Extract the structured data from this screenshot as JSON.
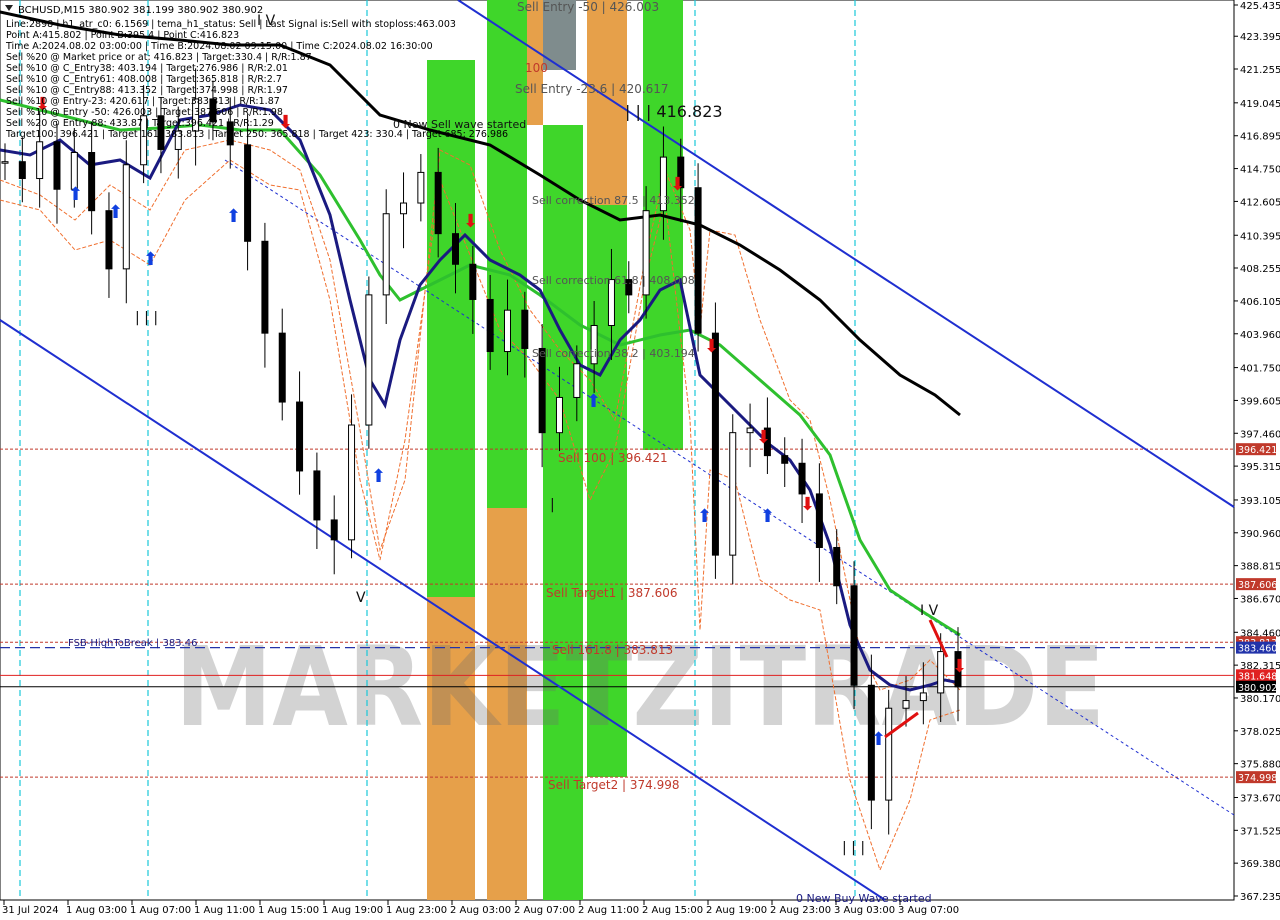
{
  "window": {
    "symbol_header": "BCHUSD,M15  380.902 381.199 380.902 380.902"
  },
  "info_lines": [
    "Line:2898 | h1_atr_c0: 6.1569 | tema_h1_status: Sell | Last Signal is:Sell with stoploss:463.003",
    "Point A:415.802 | Point B:395.4 | Point C:416.823",
    "Time A:2024.08.02 03:00:00 | Time B:2024.08.02 09:15:00 | Time C:2024.08.02 16:30:00",
    "Sell %20 @ Market price or at: 416.823 | Target:330.4 | R/R:1.87",
    "Sell %10 @ C_Entry38: 403.194 | Target:276.986 | R/R:2.01",
    "Sell %10 @ C_Entry61: 408.008 | Target:365.818 | R/R:2.7",
    "Sell %10 @ C_Entry88: 413.352 | Target:374.998 | R/R:1.97",
    "Sell %10 @ Entry-23: 420.617 | Target:383.813 | R/R:1.87",
    "Sell %10 @ Entry -50: 426.003 | Target:387.606 | R/R:1.98",
    "Sell %20 @ Entry-88: 433.87 | Target:396.421 | R/R:1.29",
    "Target100: 396.421 | Target 161: 383.813 | Target 250: 365.818 | Target 423: 330.4 | Target 685: 276.986"
  ],
  "annotations": {
    "sell_entry_50": "Sell Entry -50 | 426.003",
    "sell_entry_23": "Sell Entry -23.6 | 420.617",
    "point_c_label": "| | | 416.823",
    "new_sell_wave": "0 New Sell wave started",
    "sell_corr_875": "Sell correction 87.5 | 413.352",
    "sell_corr_618": "Sell correction 61.8 | 408.008",
    "sell_corr_382": "Sell correction 38.2 | 403.194",
    "sell_100": "Sell 100 | 396.421",
    "sell_target1": "Sell Target1 | 387.606",
    "fsb_label": "FSB-HighToBreak | 383.46",
    "sell_161": "Sell 161.8 | 383.813",
    "sell_target2": "Sell Target2 | 374.998",
    "new_buy_wave": "0 New Buy Wave started",
    "label_100": "100",
    "watermark": "MARKETZITRADE"
  },
  "chart_data": {
    "type": "candlestick",
    "symbol": "BCHUSD",
    "timeframe": "M15",
    "last_price": 380.902,
    "y_axis": {
      "ticks": [
        "425.435",
        "423.395",
        "421.255",
        "419.045",
        "416.895",
        "414.750",
        "412.605",
        "410.395",
        "408.255",
        "406.105",
        "403.960",
        "401.750",
        "399.605",
        "397.460",
        "395.315",
        "393.105",
        "390.960",
        "388.815",
        "386.670",
        "384.460",
        "382.315",
        "380.170",
        "378.025",
        "375.880",
        "373.670",
        "371.525",
        "369.380",
        "367.235"
      ],
      "range": [
        367.235,
        425.435
      ]
    },
    "x_axis": {
      "ticks": [
        "31 Jul 2024",
        "1 Aug 03:00",
        "1 Aug 07:00",
        "1 Aug 11:00",
        "1 Aug 15:00",
        "1 Aug 19:00",
        "1 Aug 23:00",
        "2 Aug 03:00",
        "2 Aug 07:00",
        "2 Aug 11:00",
        "2 Aug 15:00",
        "2 Aug 19:00",
        "2 Aug 23:00",
        "3 Aug 03:00",
        "3 Aug 07:00"
      ]
    },
    "price_levels": [
      {
        "label": "396.421",
        "value": 396.421,
        "color": "#c0392b"
      },
      {
        "label": "387.606",
        "value": 387.606,
        "color": "#c0392b"
      },
      {
        "label": "383.813",
        "value": 383.813,
        "color": "#c0392b"
      },
      {
        "label": "383.460",
        "value": 383.46,
        "color": "#2233aa"
      },
      {
        "label": "381.648",
        "value": 381.648,
        "color": "#e02020"
      },
      {
        "label": "380.902",
        "value": 380.902,
        "color": "#000000"
      },
      {
        "label": "374.998",
        "value": 374.998,
        "color": "#c0392b"
      }
    ],
    "close_series": [
      {
        "t": "31 Jul 21:00",
        "c": 415.2
      },
      {
        "t": "1 Aug 00:00",
        "c": 414.1
      },
      {
        "t": "1 Aug 01:00",
        "c": 416.5
      },
      {
        "t": "1 Aug 03:00",
        "c": 413.4
      },
      {
        "t": "1 Aug 05:00",
        "c": 415.8
      },
      {
        "t": "1 Aug 07:00",
        "c": 412.0
      },
      {
        "t": "1 Aug 08:00",
        "c": 408.2
      },
      {
        "t": "1 Aug 09:00",
        "c": 415.0
      },
      {
        "t": "1 Aug 10:00",
        "c": 418.2
      },
      {
        "t": "1 Aug 11:00",
        "c": 416.0
      },
      {
        "t": "1 Aug 12:00",
        "c": 417.2
      },
      {
        "t": "1 Aug 13:00",
        "c": 419.3
      },
      {
        "t": "1 Aug 14:00",
        "c": 417.8
      },
      {
        "t": "1 Aug 15:00",
        "c": 416.3
      },
      {
        "t": "1 Aug 16:00",
        "c": 410.0
      },
      {
        "t": "1 Aug 17:00",
        "c": 404.0
      },
      {
        "t": "1 Aug 18:00",
        "c": 399.5
      },
      {
        "t": "1 Aug 19:00",
        "c": 395.0
      },
      {
        "t": "1 Aug 20:00",
        "c": 391.8
      },
      {
        "t": "1 Aug 21:00",
        "c": 390.5
      },
      {
        "t": "1 Aug 22:00",
        "c": 398.0
      },
      {
        "t": "1 Aug 23:00",
        "c": 406.5
      },
      {
        "t": "2 Aug 00:00",
        "c": 411.8
      },
      {
        "t": "2 Aug 01:00",
        "c": 412.5
      },
      {
        "t": "2 Aug 02:00",
        "c": 414.5
      },
      {
        "t": "2 Aug 03:00",
        "c": 410.5
      },
      {
        "t": "2 Aug 04:00",
        "c": 408.5
      },
      {
        "t": "2 Aug 05:00",
        "c": 406.2
      },
      {
        "t": "2 Aug 06:00",
        "c": 402.8
      },
      {
        "t": "2 Aug 07:00",
        "c": 405.5
      },
      {
        "t": "2 Aug 08:00",
        "c": 403.0
      },
      {
        "t": "2 Aug 09:00",
        "c": 397.5
      },
      {
        "t": "2 Aug 10:00",
        "c": 399.8
      },
      {
        "t": "2 Aug 11:00",
        "c": 402.0
      },
      {
        "t": "2 Aug 12:00",
        "c": 404.5
      },
      {
        "t": "2 Aug 13:00",
        "c": 407.5
      },
      {
        "t": "2 Aug 14:00",
        "c": 406.5
      },
      {
        "t": "2 Aug 15:00",
        "c": 412.0
      },
      {
        "t": "2 Aug 16:00",
        "c": 415.5
      },
      {
        "t": "2 Aug 16:30",
        "c": 413.5
      },
      {
        "t": "2 Aug 17:00",
        "c": 404.0
      },
      {
        "t": "2 Aug 18:00",
        "c": 389.5
      },
      {
        "t": "2 Aug 19:00",
        "c": 397.5
      },
      {
        "t": "2 Aug 20:00",
        "c": 397.8
      },
      {
        "t": "2 Aug 21:00",
        "c": 396.0
      },
      {
        "t": "2 Aug 22:00",
        "c": 395.5
      },
      {
        "t": "2 Aug 23:00",
        "c": 393.5
      },
      {
        "t": "3 Aug 00:00",
        "c": 390.0
      },
      {
        "t": "3 Aug 01:00",
        "c": 387.5
      },
      {
        "t": "3 Aug 02:00",
        "c": 381.0
      },
      {
        "t": "3 Aug 03:00",
        "c": 373.5
      },
      {
        "t": "3 Aug 04:00",
        "c": 379.5
      },
      {
        "t": "3 Aug 05:00",
        "c": 380.0
      },
      {
        "t": "3 Aug 06:00",
        "c": 380.5
      },
      {
        "t": "3 Aug 07:00",
        "c": 383.2
      },
      {
        "t": "3 Aug 08:00",
        "c": 380.9
      }
    ]
  },
  "colors": {
    "green_zone": "#3fd62a",
    "orange_zone": "#e6a04a",
    "gray_zone": "#7f8c8d",
    "channel": "#1f2fd0",
    "ma_black": "#000000",
    "ma_green": "#2ec02e",
    "ma_navy": "#1a1a80",
    "level_red": "#c0392b",
    "arrow_red": "#e01010",
    "arrow_blue": "#1040e0"
  }
}
